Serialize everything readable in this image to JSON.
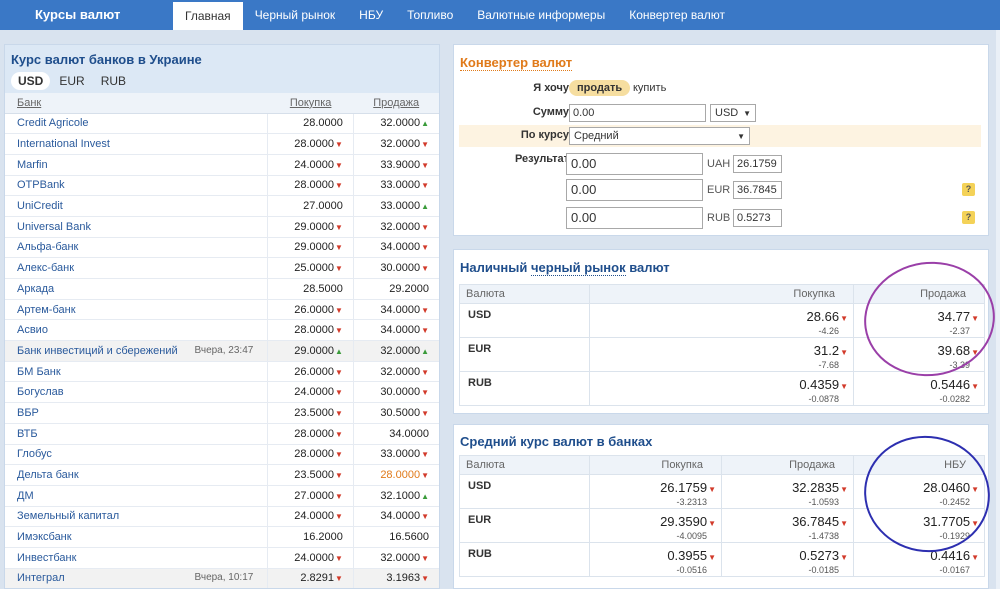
{
  "header": {
    "brand": "Курсы валют",
    "nav": [
      {
        "label": "Главная",
        "active": true
      },
      {
        "label": "Черный рынок"
      },
      {
        "label": "НБУ"
      },
      {
        "label": "Топливо"
      },
      {
        "label": "Валютные информеры"
      },
      {
        "label": "Конвертер валют"
      }
    ]
  },
  "banks_panel": {
    "title": "Курс валют банков в Украине",
    "currency_tabs": [
      "USD",
      "EUR",
      "RUB"
    ],
    "selected_tab": "USD",
    "columns": [
      "Банк",
      "Покупка",
      "Продажа"
    ],
    "rows": [
      {
        "name": "Credit Agricole",
        "buy": "28.0000",
        "buy_trend": "",
        "sell": "32.0000",
        "sell_trend": "up"
      },
      {
        "name": "International Invest",
        "buy": "28.0000",
        "buy_trend": "down",
        "sell": "32.0000",
        "sell_trend": "down"
      },
      {
        "name": "Marfin",
        "buy": "24.0000",
        "buy_trend": "down",
        "sell": "33.9000",
        "sell_trend": "down"
      },
      {
        "name": "OTPBank",
        "buy": "28.0000",
        "buy_trend": "down",
        "sell": "33.0000",
        "sell_trend": "down"
      },
      {
        "name": "UniCredit",
        "buy": "27.0000",
        "buy_trend": "",
        "sell": "33.0000",
        "sell_trend": "up"
      },
      {
        "name": "Universal Bank",
        "buy": "29.0000",
        "buy_trend": "down",
        "sell": "32.0000",
        "sell_trend": "down"
      },
      {
        "name": "Альфа-банк",
        "buy": "29.0000",
        "buy_trend": "down",
        "sell": "34.0000",
        "sell_trend": "down"
      },
      {
        "name": "Алекс-банк",
        "buy": "25.0000",
        "buy_trend": "down",
        "sell": "30.0000",
        "sell_trend": "down"
      },
      {
        "name": "Аркада",
        "buy": "28.5000",
        "buy_trend": "",
        "sell": "29.2000",
        "sell_trend": ""
      },
      {
        "name": "Артем-банк",
        "buy": "26.0000",
        "buy_trend": "down",
        "sell": "34.0000",
        "sell_trend": "down"
      },
      {
        "name": "Асвио",
        "buy": "28.0000",
        "buy_trend": "down",
        "sell": "34.0000",
        "sell_trend": "down"
      },
      {
        "name": "Банк инвестиций и сбережений",
        "time": "Вчера, 23:47",
        "gray": true,
        "buy": "29.0000",
        "buy_trend": "up",
        "sell": "32.0000",
        "sell_trend": "up"
      },
      {
        "name": "БМ Банк",
        "buy": "26.0000",
        "buy_trend": "down",
        "sell": "32.0000",
        "sell_trend": "down"
      },
      {
        "name": "Богуслав",
        "buy": "24.0000",
        "buy_trend": "down",
        "sell": "30.0000",
        "sell_trend": "down"
      },
      {
        "name": "ВБР",
        "buy": "23.5000",
        "buy_trend": "down",
        "sell": "30.5000",
        "sell_trend": "down"
      },
      {
        "name": "ВТБ",
        "buy": "28.0000",
        "buy_trend": "down",
        "sell": "34.0000",
        "sell_trend": ""
      },
      {
        "name": "Глобус",
        "buy": "28.0000",
        "buy_trend": "down",
        "sell": "33.0000",
        "sell_trend": "down"
      },
      {
        "name": "Дельта банк",
        "buy": "23.5000",
        "buy_trend": "down",
        "sell": "28.0000",
        "sell_trend": "down",
        "sell_orange": true
      },
      {
        "name": "ДМ",
        "buy": "27.0000",
        "buy_trend": "down",
        "sell": "32.1000",
        "sell_trend": "up"
      },
      {
        "name": "Земельный капитал",
        "buy": "24.0000",
        "buy_trend": "down",
        "sell": "34.0000",
        "sell_trend": "down"
      },
      {
        "name": "Имэксбанк",
        "buy": "16.2000",
        "buy_trend": "",
        "sell": "16.5600",
        "sell_trend": ""
      },
      {
        "name": "Инвестбанк",
        "buy": "24.0000",
        "buy_trend": "down",
        "sell": "32.0000",
        "sell_trend": "down"
      },
      {
        "name": "Интеграл",
        "time": "Вчера, 10:17",
        "gray": true,
        "buy": "2.8291",
        "buy_trend": "down",
        "sell": "3.1963",
        "sell_trend": "down"
      }
    ]
  },
  "converter": {
    "title": "Конвертер валют",
    "want_label": "Я хочу",
    "sell_label": "продать",
    "buy_label": "купить",
    "sum_label": "Сумму",
    "sum_value": "0.00",
    "sum_currency": "USD",
    "rate_label": "По курсу",
    "rate_value": "Средний",
    "result_label": "Результат",
    "results": [
      {
        "value": "0.00",
        "currency": "UAH",
        "rate": "26.1759"
      },
      {
        "value": "0.00",
        "currency": "EUR",
        "rate": "36.7845"
      },
      {
        "value": "0.00",
        "currency": "RUB",
        "rate": "0.5273"
      }
    ],
    "help_glyph": "?"
  },
  "black_market": {
    "title_prefix": "Наличный ",
    "title_link": "черный рынок",
    "title_suffix": " валют",
    "columns": [
      "Валюта",
      "Покупка",
      "Продажа"
    ],
    "rows": [
      {
        "cur": "USD",
        "buy": "28.66",
        "buy_d": "-4.26",
        "sell": "34.77",
        "sell_d": "-2.37"
      },
      {
        "cur": "EUR",
        "buy": "31.2",
        "buy_d": "-7.68",
        "sell": "39.68",
        "sell_d": "-3.39"
      },
      {
        "cur": "RUB",
        "buy": "0.4359",
        "buy_d": "-0.0878",
        "sell": "0.5446",
        "sell_d": "-0.0282"
      }
    ]
  },
  "avg_rates": {
    "title": "Средний курс валют в банках",
    "columns": [
      "Валюта",
      "Покупка",
      "Продажа",
      "НБУ"
    ],
    "rows": [
      {
        "cur": "USD",
        "buy": "26.1759",
        "buy_d": "-3.2313",
        "sell": "32.2835",
        "sell_d": "-1.0593",
        "nbu": "28.0460",
        "nbu_d": "-0.2452"
      },
      {
        "cur": "EUR",
        "buy": "29.3590",
        "buy_d": "-4.0095",
        "sell": "36.7845",
        "sell_d": "-1.4738",
        "nbu": "31.7705",
        "nbu_d": "-0.1929"
      },
      {
        "cur": "RUB",
        "buy": "0.3955",
        "buy_d": "-0.0516",
        "sell": "0.5273",
        "sell_d": "-0.0185",
        "nbu": "0.4416",
        "nbu_d": "-0.0167"
      }
    ]
  },
  "colors": {
    "nav_bg": "#3a78c6",
    "title_blue": "#1f4e8c",
    "up": "#3a9b3a",
    "down": "#d23a2a",
    "annotation_purple": "#9a3fa8",
    "annotation_blue": "#2d2fb0"
  }
}
